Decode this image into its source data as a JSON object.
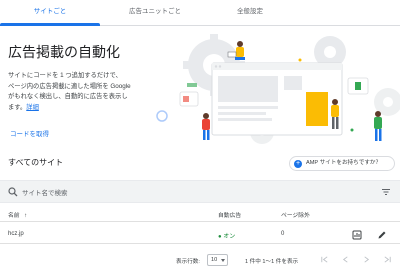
{
  "tabs": [
    {
      "label": "サイトごと",
      "active": true
    },
    {
      "label": "広告ユニットごと",
      "active": false
    },
    {
      "label": "全般設定",
      "active": false
    }
  ],
  "hero": {
    "title": "広告掲載の自動化",
    "desc_lines": [
      "サイトにコードを 1 つ追加するだけで、",
      "ページ内の広告掲載に適した場所を Google",
      "がもれなく検出し、自動的に広告を表示し",
      "ます。"
    ],
    "learn_more": "詳細",
    "get_code": "コードを取得"
  },
  "sites": {
    "title": "すべてのサイト",
    "amp_button": "AMP サイトをお持ちですか？",
    "search_placeholder": "サイト名で検索"
  },
  "table": {
    "headers": {
      "name": "名前",
      "auto_ads": "自動広告",
      "page_exclusions": "ページ除外"
    },
    "rows": [
      {
        "name": "hcz.jp",
        "auto_ads": "オン",
        "page_exclusions": "0"
      }
    ]
  },
  "pagination": {
    "rows_label": "表示行数:",
    "rows_value": "10",
    "count_text": "1 件中 1～1 件を表示"
  },
  "colors": {
    "accent": "#1a73e8",
    "on_green": "#1e8e3e"
  },
  "icons": [
    "search-icon",
    "filter-icon",
    "sort-arrow-icon",
    "report-icon",
    "edit-pencil-icon",
    "first-page-icon",
    "prev-page-icon",
    "next-page-icon",
    "last-page-icon",
    "add-circle-icon"
  ]
}
